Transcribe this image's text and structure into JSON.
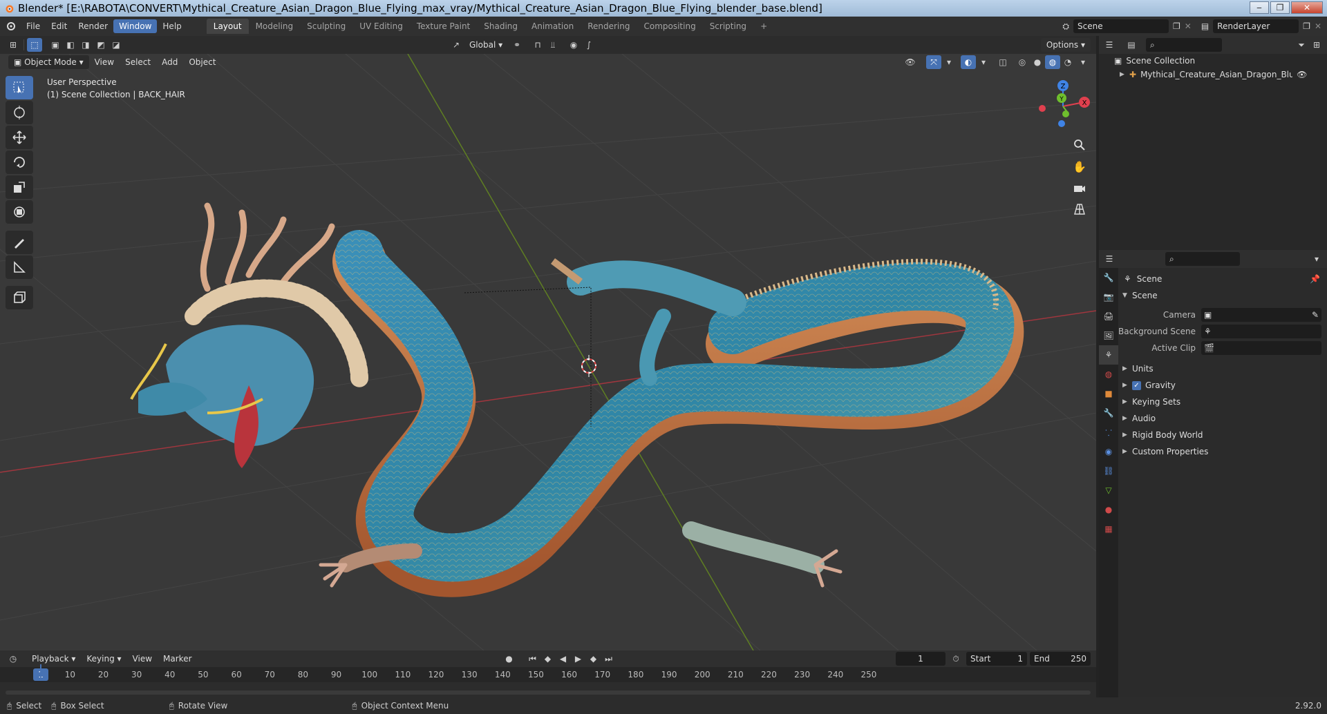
{
  "titlebar": {
    "title": "Blender* [E:\\RABOTA\\CONVERT\\Mythical_Creature_Asian_Dragon_Blue_Flying_max_vray/Mythical_Creature_Asian_Dragon_Blue_Flying_blender_base.blend]"
  },
  "menu": {
    "file": "File",
    "edit": "Edit",
    "render": "Render",
    "window": "Window",
    "help": "Help"
  },
  "workspaces": [
    "Layout",
    "Modeling",
    "Sculpting",
    "UV Editing",
    "Texture Paint",
    "Shading",
    "Animation",
    "Rendering",
    "Compositing",
    "Scripting"
  ],
  "scene_selector": "Scene",
  "renderlayer_selector": "RenderLayer",
  "view_header": {
    "orientation": "Global",
    "options": "Options"
  },
  "mode_bar": {
    "mode": "Object Mode",
    "view": "View",
    "select": "Select",
    "add": "Add",
    "object": "Object"
  },
  "viewport": {
    "perspective": "User Perspective",
    "collection_info": "(1) Scene Collection | BACK_HAIR"
  },
  "gizmo": {
    "z": "Z",
    "y": "Y",
    "x": "X"
  },
  "outliner": {
    "root": "Scene Collection",
    "item": "Mythical_Creature_Asian_Dragon_Blue_Flyir"
  },
  "properties": {
    "header": "Scene",
    "panel_title": "Scene",
    "camera_label": "Camera",
    "background_label": "Background Scene",
    "clip_label": "Active Clip",
    "subpanels": [
      "Units",
      "Gravity",
      "Keying Sets",
      "Audio",
      "Rigid Body World",
      "Custom Properties"
    ],
    "gravity_checked": true
  },
  "timeline": {
    "playback": "Playback",
    "keying": "Keying",
    "view": "View",
    "marker": "Marker",
    "current_frame": "1",
    "start_label": "Start",
    "start": "1",
    "end_label": "End",
    "end": "250",
    "ticks": [
      "10",
      "20",
      "30",
      "40",
      "50",
      "60",
      "70",
      "80",
      "90",
      "100",
      "110",
      "120",
      "130",
      "140",
      "150",
      "160",
      "170",
      "180",
      "190",
      "200",
      "210",
      "220",
      "230",
      "240",
      "250"
    ],
    "playhead": "1"
  },
  "statusbar": {
    "select": "Select",
    "box_select": "Box Select",
    "rotate": "Rotate View",
    "context": "Object Context Menu",
    "version": "2.92.0"
  },
  "colors": {
    "accent": "#4772b3",
    "x_axis": "#e0404e",
    "y_axis": "#6fbf2d",
    "z_axis": "#3f83e6"
  }
}
